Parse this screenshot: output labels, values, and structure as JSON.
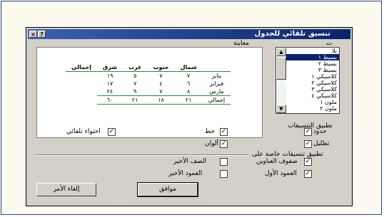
{
  "dialog": {
    "title": "تنسيق تلقائي للجدول",
    "help_btn": "?",
    "close_btn": "×"
  },
  "formats": {
    "label": "ت",
    "items": [
      "بلا",
      "بسيط ١",
      "بسيط ٢",
      "بسيط ٣",
      "كلاسيكي ١",
      "كلاسيكي ٢",
      "كلاسيكي ٣",
      "كلاسيكي ٤",
      "ملون ١",
      "ملون ٢"
    ],
    "selected_index": 1
  },
  "preview": {
    "label": "معاينة",
    "headers": [
      "شمال",
      "جنوب",
      "غرب",
      "شرق",
      "إجمالي"
    ],
    "rows": [
      [
        "يناير",
        "٧",
        "٧",
        "٥",
        "١٩"
      ],
      [
        "فبراير",
        "٦",
        "٤",
        "٧",
        "١٧"
      ],
      [
        "مارس",
        "٨",
        "٧",
        "٩",
        "٢٤"
      ],
      [
        "إجمالي",
        "٢١",
        "١٨",
        "٢١",
        "٦٠"
      ]
    ]
  },
  "apply_formats": {
    "label": "تطبيق التنسيقات",
    "checkboxes": [
      {
        "label": "حدود",
        "checked": true
      },
      {
        "label": "خط",
        "checked": true
      },
      {
        "label": "تظليل",
        "checked": true
      },
      {
        "label": "ألوان",
        "checked": true
      },
      {
        "label": "احتواء تلقائي",
        "checked": true
      }
    ]
  },
  "apply_special": {
    "label": "تطبيق تنسيقات خاصة على",
    "checkboxes": [
      {
        "label": "صفوف العناوين",
        "checked": true
      },
      {
        "label": "العمود الأول",
        "checked": true
      },
      {
        "label": "الصف الأخير",
        "checked": false
      },
      {
        "label": "العمود الأخير",
        "checked": false
      }
    ]
  },
  "buttons": {
    "ok": "موافق",
    "cancel": "إلغاء الأمر"
  }
}
